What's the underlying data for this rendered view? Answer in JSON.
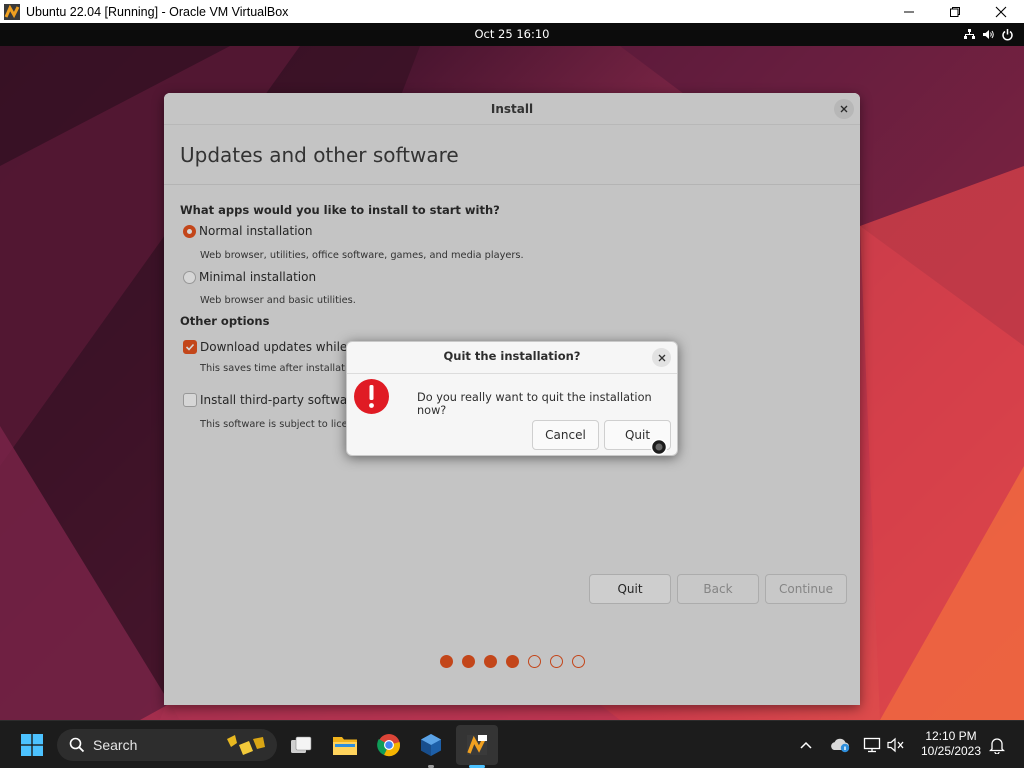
{
  "host": {
    "window_title": "Ubuntu 22.04 [Running] - Oracle VM VirtualBox",
    "controls": [
      "minimize-icon",
      "maximize-icon",
      "close-icon"
    ]
  },
  "ubuntu_topbar": {
    "datetime": "Oct 25  16:10",
    "tray_icons": [
      "network-icon",
      "volume-icon",
      "power-icon"
    ]
  },
  "install_window": {
    "title": "Install",
    "page_title": "Updates and other software",
    "apps_question": "What apps would you like to install to start with?",
    "options": [
      {
        "label": "Normal installation",
        "selected": true,
        "desc": "Web browser, utilities, office software, games, and media players."
      },
      {
        "label": "Minimal installation",
        "selected": false,
        "desc": "Web browser and basic utilities."
      }
    ],
    "other_options_heading": "Other options",
    "checks": [
      {
        "label": "Download updates while ins",
        "checked": true,
        "desc": "This saves time after installation."
      },
      {
        "label": "Install third-party software",
        "checked": false,
        "desc": "This software is subject to license"
      }
    ],
    "buttons": {
      "quit": "Quit",
      "back": "Back",
      "continue": "Continue"
    },
    "progress_dots": {
      "filled": 4,
      "total": 7
    }
  },
  "quit_dialog": {
    "title": "Quit the installation?",
    "message": "Do you really want to quit the installation now?",
    "cancel": "Cancel",
    "quit": "Quit"
  },
  "taskbar": {
    "search_label": "Search",
    "apps": [
      "start-icon",
      "task-view-icon",
      "file-explorer-icon",
      "chrome-icon",
      "virtualbox-icon",
      "virtualbox-vm-icon"
    ],
    "time": "12:10 PM",
    "date": "10/25/2023"
  },
  "colors": {
    "accent": "#e95420",
    "error": "#e01b24"
  }
}
